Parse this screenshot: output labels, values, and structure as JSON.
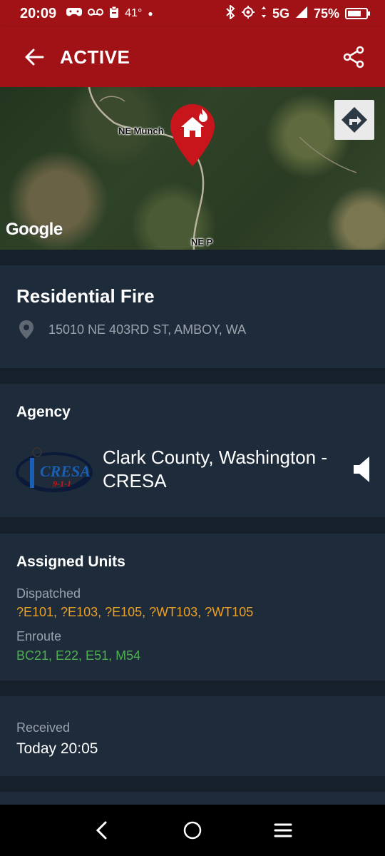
{
  "status_bar": {
    "time": "20:09",
    "temperature": "41°",
    "network": "5G",
    "battery_percent": "75%",
    "battery_level": 0.75
  },
  "app_bar": {
    "title": "ACTIVE"
  },
  "map": {
    "label_top": "NE Munch",
    "label_bottom": "NE P",
    "google_logo": "Google"
  },
  "incident": {
    "type": "Residential Fire",
    "address": "15010 NE 403RD ST, AMBOY, WA"
  },
  "agency": {
    "section_title": "Agency",
    "name": "Clark County, Washington - CRESA",
    "logo_text": "CRESA",
    "logo_subtext": "9-1-1"
  },
  "units": {
    "section_title": "Assigned Units",
    "dispatched_label": "Dispatched",
    "dispatched_value": "?E101, ?E103, ?E105, ?WT103, ?WT105",
    "dispatched_color": "#f0a020",
    "enroute_label": "Enroute",
    "enroute_value": "BC21, E22, E51, M54",
    "enroute_color": "#4caf50"
  },
  "received": {
    "label": "Received",
    "value": "Today 20:05"
  },
  "colors": {
    "header_red": "#a11216",
    "card_bg": "#1e2b3a",
    "page_bg": "#16202b",
    "pin_red": "#c8151b"
  }
}
